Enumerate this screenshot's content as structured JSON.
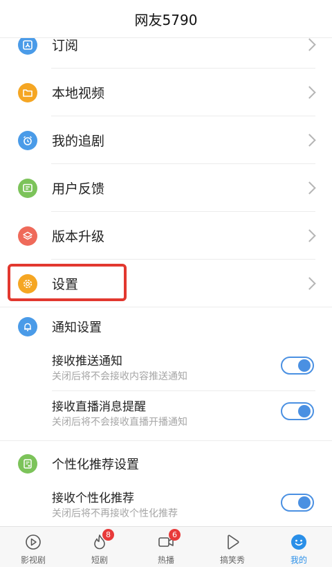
{
  "header": {
    "title": "网友5790"
  },
  "menu": [
    {
      "label": "订阅",
      "icon": "subscribe-icon",
      "color": "#4a9be8"
    },
    {
      "label": "本地视频",
      "icon": "folder-icon",
      "color": "#f5a623"
    },
    {
      "label": "我的追剧",
      "icon": "alarm-clock-icon",
      "color": "#4a9be8"
    },
    {
      "label": "用户反馈",
      "icon": "feedback-icon",
      "color": "#7cc35a"
    },
    {
      "label": "版本升级",
      "icon": "layers-icon",
      "color": "#ef6a5a"
    },
    {
      "label": "设置",
      "icon": "gear-icon",
      "color": "#f5a623"
    }
  ],
  "notify": {
    "title": "通知设置",
    "items": [
      {
        "title": "接收推送通知",
        "desc": "关闭后将不会接收内容推送通知",
        "on": true
      },
      {
        "title": "接收直播消息提醒",
        "desc": "关闭后将不会接收直播开播通知",
        "on": true
      }
    ]
  },
  "personal": {
    "title": "个性化推荐设置",
    "items": [
      {
        "title": "接收个性化推荐",
        "desc": "关闭后将不再接收个性化推荐",
        "on": true
      }
    ]
  },
  "tabs": [
    {
      "label": "影视剧",
      "icon": "play-circle-icon",
      "badge": ""
    },
    {
      "label": "短剧",
      "icon": "fire-icon",
      "badge": "8"
    },
    {
      "label": "热播",
      "icon": "video-camera-icon",
      "badge": "6"
    },
    {
      "label": "搞笑秀",
      "icon": "play-triangle-icon",
      "badge": ""
    },
    {
      "label": "我的",
      "icon": "smile-icon",
      "badge": "",
      "active": true
    }
  ],
  "colors": {
    "accent": "#4a90e2",
    "highlight": "#e2382f",
    "badge": "#e83a3a"
  }
}
